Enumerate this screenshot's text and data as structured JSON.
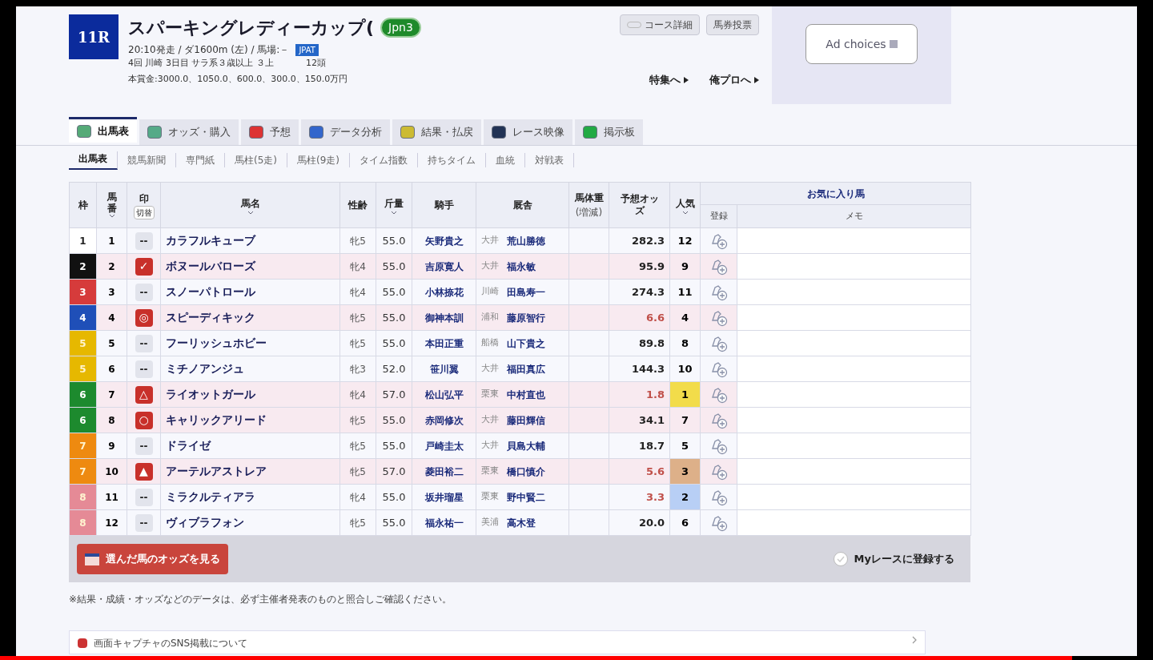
{
  "race": {
    "number": "11R",
    "title": "スパーキングレディーカップ(",
    "grade": "Jpn3",
    "info": "20:10発走 / ダ1600m (左) / 馬場:－",
    "info_badge": "JPAT",
    "detail": "4回 川崎 3日目 サラ系３歳以上 ３上",
    "runners": "12頭",
    "prize": "本賞金:3000.0、1050.0、600.0、300.0、150.0万円"
  },
  "header_buttons": [
    "コース詳細",
    "馬券投票"
  ],
  "header_links": [
    "特集へ",
    "俺プロへ"
  ],
  "ad": {
    "label": "Ad choices"
  },
  "tabs": [
    {
      "label": "出馬表",
      "selected": true
    },
    {
      "label": "オッズ・購入",
      "selected": false
    },
    {
      "label": "予想",
      "selected": false
    },
    {
      "label": "データ分析",
      "selected": false
    },
    {
      "label": "結果・払戻",
      "selected": false
    },
    {
      "label": "レース映像",
      "selected": false
    },
    {
      "label": "掲示板",
      "selected": false
    }
  ],
  "subtabs": [
    {
      "label": "出馬表",
      "selected": true
    },
    {
      "label": "競馬新聞",
      "selected": false
    },
    {
      "label": "専門紙",
      "selected": false
    },
    {
      "label": "馬柱(5走)",
      "selected": false
    },
    {
      "label": "馬柱(9走)",
      "selected": false
    },
    {
      "label": "タイム指数",
      "selected": false
    },
    {
      "label": "持ちタイム",
      "selected": false
    },
    {
      "label": "血統",
      "selected": false
    },
    {
      "label": "対戦表",
      "selected": false
    }
  ],
  "table": {
    "columns": {
      "waku": "枠",
      "umaban": "馬番",
      "mark": "印",
      "mark_toggle": "切替",
      "name": "馬名",
      "sex_age": "性齢",
      "weight": "斤量",
      "jockey": "騎手",
      "trainer": "厩舎",
      "body_weight": "馬体重",
      "body_weight_sub": "(増減)",
      "odds": "予想オッズ",
      "popularity": "人気",
      "favorite": "お気に入り馬",
      "register": "登録",
      "memo": "メモ"
    },
    "rows": [
      {
        "waku": {
          "text": "1",
          "color": "#ffffff"
        },
        "umaban": "1",
        "mark": {
          "kind": "blank",
          "text": "--"
        },
        "name": "カラフルキューブ",
        "sex_age": "牝5",
        "weight": "55.0",
        "jockey": "矢野貴之",
        "region": "大井",
        "trainer": "荒山勝徳",
        "odds": "282.3",
        "odds_hot": false,
        "popularity": {
          "text": "12"
        }
      },
      {
        "waku": {
          "text": "2",
          "color": "#111111"
        },
        "umaban": "2",
        "mark": {
          "kind": "marked",
          "text": "✓"
        },
        "name": "ボヌールバローズ",
        "sex_age": "牝4",
        "weight": "55.0",
        "jockey": "吉原寛人",
        "region": "大井",
        "trainer": "福永敏",
        "odds": "95.9",
        "odds_hot": false,
        "popularity": {
          "text": "9"
        }
      },
      {
        "waku": {
          "text": "3",
          "color": "#d63b3b"
        },
        "umaban": "3",
        "mark": {
          "kind": "blank",
          "text": "--"
        },
        "name": "スノーパトロール",
        "sex_age": "牝4",
        "weight": "55.0",
        "jockey": "小林捺花",
        "region": "川崎",
        "trainer": "田島寿一",
        "odds": "274.3",
        "odds_hot": false,
        "popularity": {
          "text": "11"
        }
      },
      {
        "waku": {
          "text": "4",
          "color": "#1f4fb8"
        },
        "umaban": "4",
        "mark": {
          "kind": "marked",
          "text": "◎"
        },
        "name": "スピーディキック",
        "sex_age": "牝5",
        "weight": "55.0",
        "jockey": "御神本訓",
        "region": "浦和",
        "trainer": "藤原智行",
        "odds": "6.6",
        "odds_hot": true,
        "popularity": {
          "text": "4"
        }
      },
      {
        "waku": {
          "text": "5",
          "color": "#e6b800"
        },
        "umaban": "5",
        "mark": {
          "kind": "blank",
          "text": "--"
        },
        "name": "フーリッシュホビー",
        "sex_age": "牝5",
        "weight": "55.0",
        "jockey": "本田正重",
        "region": "船橋",
        "trainer": "山下貴之",
        "odds": "89.8",
        "odds_hot": false,
        "popularity": {
          "text": "8"
        }
      },
      {
        "waku": {
          "text": "5",
          "color": "#e6b800"
        },
        "umaban": "6",
        "mark": {
          "kind": "blank",
          "text": "--"
        },
        "name": "ミチノアンジュ",
        "sex_age": "牝3",
        "weight": "52.0",
        "jockey": "笹川翼",
        "region": "大井",
        "trainer": "福田真広",
        "odds": "144.3",
        "odds_hot": false,
        "popularity": {
          "text": "10"
        }
      },
      {
        "waku": {
          "text": "6",
          "color": "#1d8a2e"
        },
        "umaban": "7",
        "mark": {
          "kind": "marked",
          "text": "△"
        },
        "name": "ライオットガール",
        "sex_age": "牝4",
        "weight": "57.0",
        "jockey": "松山弘平",
        "region": "栗東",
        "trainer": "中村直也",
        "odds": "1.8",
        "odds_hot": true,
        "popularity": {
          "text": "1",
          "color": "#f2dc4a"
        }
      },
      {
        "waku": {
          "text": "6",
          "color": "#1d8a2e"
        },
        "umaban": "8",
        "mark": {
          "kind": "marked",
          "text": "○"
        },
        "name": "キャリックアリード",
        "sex_age": "牝5",
        "weight": "55.0",
        "jockey": "赤岡修次",
        "region": "大井",
        "trainer": "藤田輝信",
        "odds": "34.1",
        "odds_hot": false,
        "popularity": {
          "text": "7"
        }
      },
      {
        "waku": {
          "text": "7",
          "color": "#ee8a10"
        },
        "umaban": "9",
        "mark": {
          "kind": "blank",
          "text": "--"
        },
        "name": "ドライゼ",
        "sex_age": "牝5",
        "weight": "55.0",
        "jockey": "戸崎圭太",
        "region": "大井",
        "trainer": "貝島大輔",
        "odds": "18.7",
        "odds_hot": false,
        "popularity": {
          "text": "5"
        }
      },
      {
        "waku": {
          "text": "7",
          "color": "#ee8a10"
        },
        "umaban": "10",
        "mark": {
          "kind": "marked",
          "text": "▲"
        },
        "name": "アーテルアストレア",
        "sex_age": "牝5",
        "weight": "57.0",
        "jockey": "菱田裕二",
        "region": "栗東",
        "trainer": "橋口慎介",
        "odds": "5.6",
        "odds_hot": true,
        "popularity": {
          "text": "3",
          "color": "#ddb089"
        }
      },
      {
        "waku": {
          "text": "8",
          "color": "#e58a96"
        },
        "umaban": "11",
        "mark": {
          "kind": "blank",
          "text": "--"
        },
        "name": "ミラクルティアラ",
        "sex_age": "牝4",
        "weight": "55.0",
        "jockey": "坂井瑠星",
        "region": "栗東",
        "trainer": "野中賢二",
        "odds": "3.3",
        "odds_hot": true,
        "popularity": {
          "text": "2",
          "color": "#b8cff5"
        }
      },
      {
        "waku": {
          "text": "8",
          "color": "#e58a96"
        },
        "umaban": "12",
        "mark": {
          "kind": "blank",
          "text": "--"
        },
        "name": "ヴィブラフォン",
        "sex_age": "牝5",
        "weight": "55.0",
        "jockey": "福永祐一",
        "region": "美浦",
        "trainer": "高木登",
        "odds": "20.0",
        "odds_hot": false,
        "popularity": {
          "text": "6"
        }
      }
    ]
  },
  "odds_button": "選んだ馬のオッズを見る",
  "my_race": {
    "label": "Myレースに登録する",
    "checked": false
  },
  "note": "※結果・成績・オッズなどのデータは、必ず主催者発表のものと照合しご確認ください。",
  "notice": "画面キャプチャのSNS掲載について",
  "video_progress": {
    "level": 0.93
  }
}
